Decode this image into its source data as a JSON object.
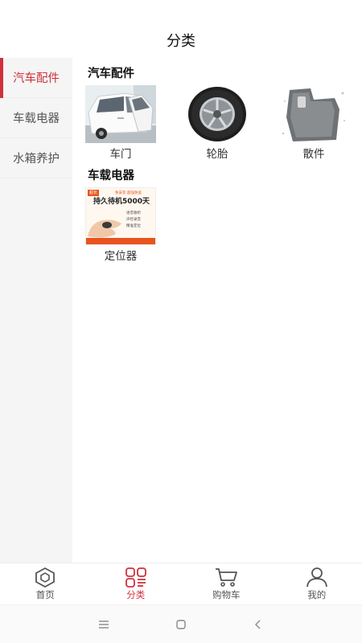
{
  "header": {
    "title": "分类"
  },
  "sidebar": {
    "items": [
      {
        "label": "汽车配件",
        "active": true
      },
      {
        "label": "车载电器",
        "active": false
      },
      {
        "label": "水箱养护",
        "active": false
      }
    ]
  },
  "sections": [
    {
      "title": "汽车配件",
      "products": [
        {
          "label": "车门",
          "image": "white-car-open-door-photo"
        },
        {
          "label": "轮胎",
          "image": "tire-wheel-photo"
        },
        {
          "label": "散件",
          "image": "car-floor-mat-photo"
        }
      ]
    },
    {
      "title": "车载电器",
      "products": [
        {
          "label": "定位器",
          "image": "gps-tracker-ad-photo",
          "ad_text": {
            "brand_tag": "超长",
            "top_tag": "免安装 超强防盗",
            "headline": "持久待机5000天",
            "features": [
              "语音收听",
              "声控录音",
              "精准定位"
            ]
          }
        }
      ]
    }
  ],
  "tabbar": {
    "items": [
      {
        "label": "首页",
        "icon": "home-hexagon-icon",
        "active": false
      },
      {
        "label": "分类",
        "icon": "category-grid-icon",
        "active": true
      },
      {
        "label": "购物车",
        "icon": "cart-icon",
        "active": false
      },
      {
        "label": "我的",
        "icon": "user-icon",
        "active": false
      }
    ]
  },
  "system_nav": {
    "icons": [
      "menu-icon",
      "home-square-icon",
      "back-chevron-icon"
    ]
  },
  "colors": {
    "accent": "#d0313b",
    "sidebar_bg": "#f5f5f5",
    "text": "#222222",
    "ad_orange": "#e8541e"
  }
}
